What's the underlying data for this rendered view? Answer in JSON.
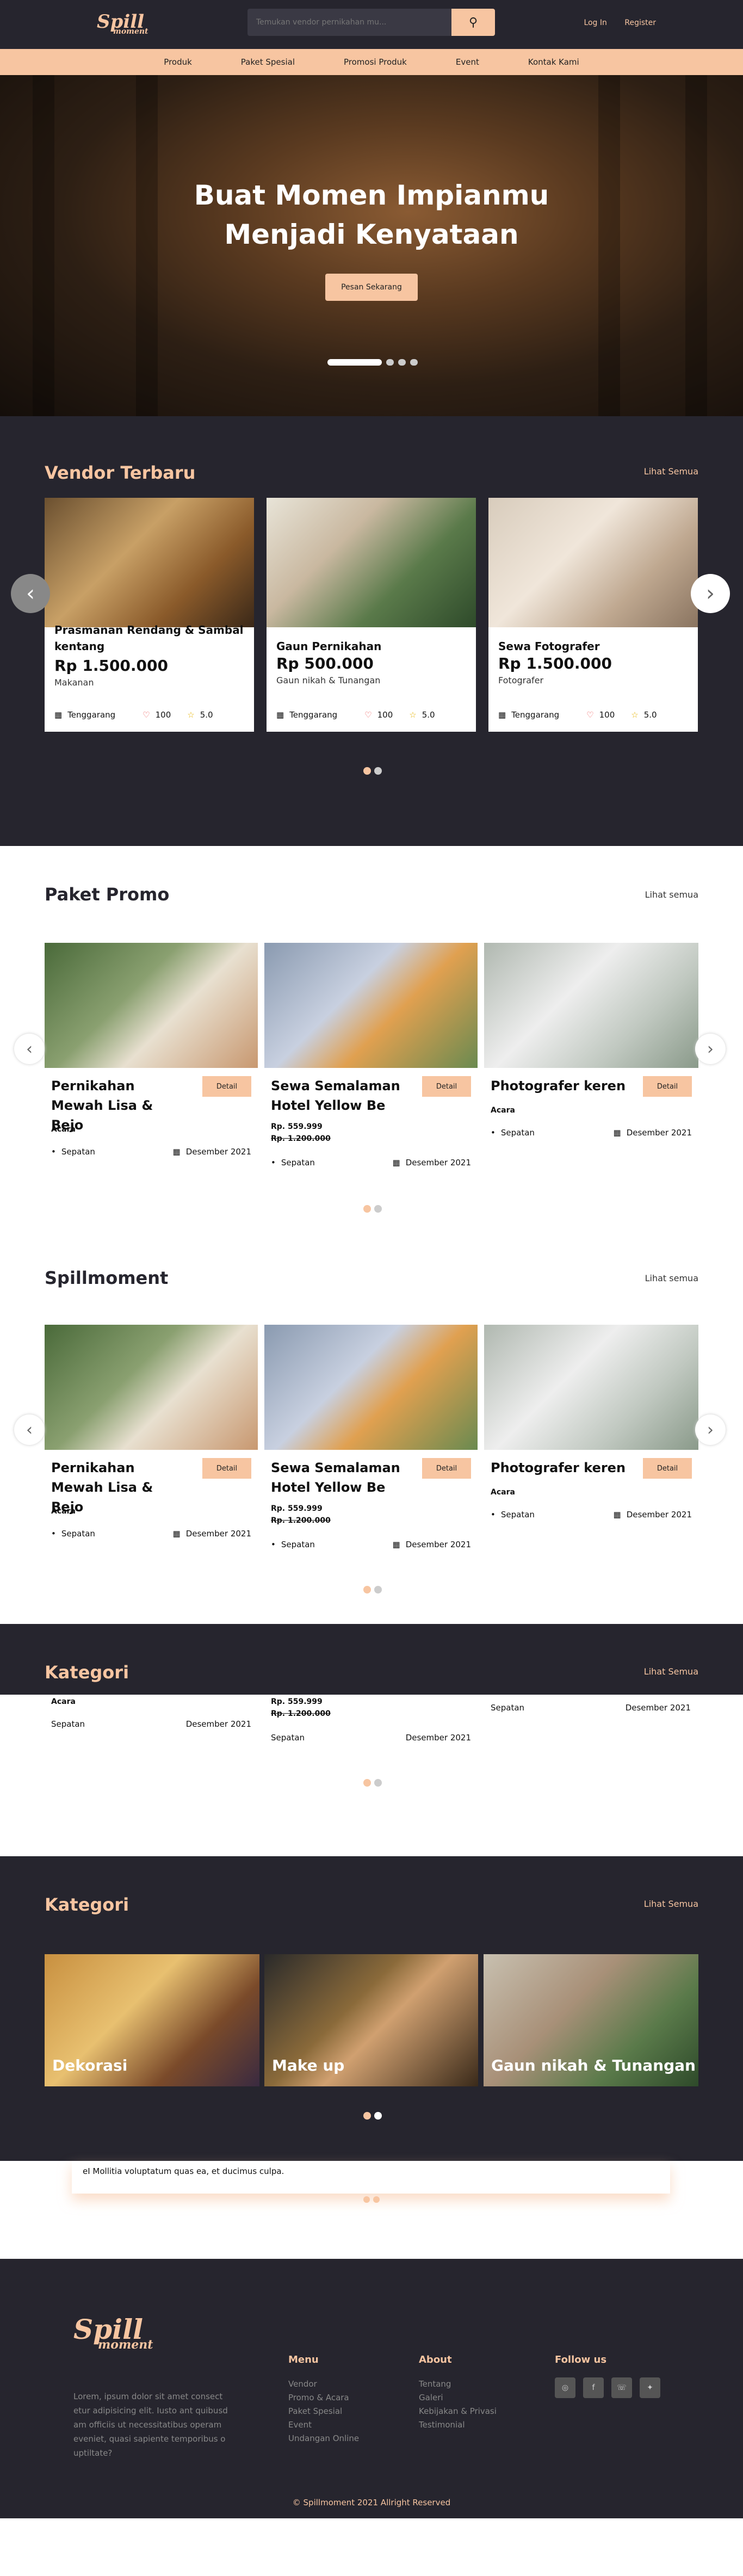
{
  "header": {
    "logo_main": "Spill",
    "logo_sub": "moment",
    "search_placeholder": "Temukan vendor pernikahan mu...",
    "login": "Log In",
    "register": "Register"
  },
  "nav": [
    "Produk",
    "Paket Spesial",
    "Promosi Produk",
    "Event",
    "Kontak Kami"
  ],
  "hero": {
    "title_line1": "Buat Momen Impianmu",
    "title_line2": "Menjadi Kenyataan",
    "button": "Pesan Sekarang"
  },
  "vendor": {
    "title": "Vendor Terbaru",
    "link": "Lihat Semua",
    "cards": [
      {
        "name": "Prasmanan Rendang & Sambal kentang",
        "price": "Rp 1.500.000",
        "category": "Makanan",
        "location": "Tenggarang",
        "likes": "100",
        "rating": "5.0"
      },
      {
        "name": "Gaun Pernikahan",
        "price": "Rp 500.000",
        "category": "Gaun nikah & Tunangan",
        "location": "Tenggarang",
        "likes": "100",
        "rating": "5.0"
      },
      {
        "name": "Sewa Fotografer",
        "price": "Rp 1.500.000",
        "category": "Fotografer",
        "location": "Tenggarang",
        "likes": "100",
        "rating": "5.0"
      }
    ]
  },
  "promo": {
    "title": "Paket Promo",
    "link": "Lihat semua",
    "detail": "Detail",
    "cards": [
      {
        "name": "Pernikahan Mewah Lisa & Bejo",
        "tag": "Acara",
        "location": "Sepatan",
        "date": "Desember 2021"
      },
      {
        "name": "Sewa Semalaman Hotel Yellow Be",
        "price": "Rp. 559.999",
        "old_price": "Rp. 1.200.000",
        "location": "Sepatan",
        "date": "Desember 2021"
      },
      {
        "name": "Photografer keren",
        "tag": "Acara",
        "location": "Sepatan",
        "date": "Desember 2021"
      }
    ]
  },
  "spill": {
    "title": "Spillmoment",
    "link": "Lihat semua"
  },
  "kategori": {
    "title": "Kategori",
    "link": "Lihat Semua",
    "items": [
      "Dekorasi",
      "Make up",
      "Gaun nikah & Tunangan"
    ]
  },
  "testimonial_text": "eI Mollitia voluptatum quas ea, et ducimus culpa.",
  "footer": {
    "desc": "Lorem, ipsum dolor sit amet consect etur adipisicing elit. Iusto ant quibusd am officiis ut necessitatibus operam eveniet, quasi sapiente temporibus o uptiltate?",
    "menu_title": "Menu",
    "menu": [
      "Vendor",
      "Promo & Acara",
      "Paket Spesial",
      "Event",
      "Undangan Online"
    ],
    "about_title": "About",
    "about": [
      "Tentang",
      "Galeri",
      "Kebijakan & Privasi",
      "Testimonial"
    ],
    "follow_title": "Follow us",
    "copyright": "© Spillmoment 2021 Allright Reserved"
  },
  "colors": {
    "dark": "#26252e",
    "accent": "#f7c5a1"
  }
}
